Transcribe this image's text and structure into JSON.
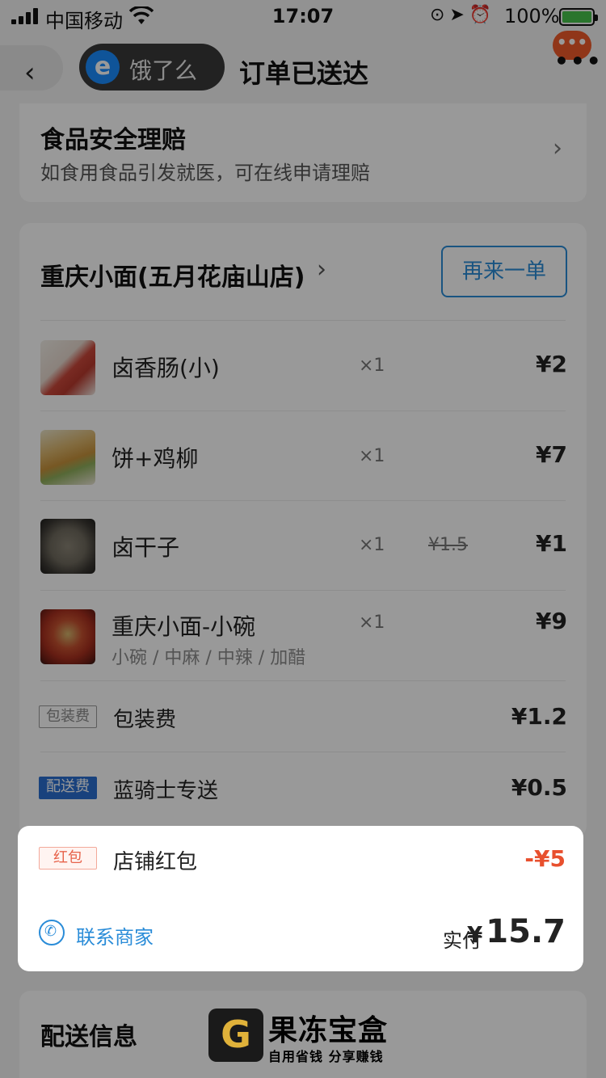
{
  "status_bar": {
    "carrier": "中国移动",
    "time": "17:07",
    "battery": "100%"
  },
  "nav": {
    "app_name": "饿了么",
    "app_logo": "e",
    "title": "订单已送达",
    "more_bubble": "•••"
  },
  "safety": {
    "title": "食品安全理赔",
    "subtitle": "如食用食品引发就医，可在线申请理赔"
  },
  "order": {
    "shop_name": "重庆小面(五月花庙山店)",
    "reorder_label": "再来一单",
    "items": [
      {
        "name": "卤香肠(小)",
        "qty": "×1",
        "original": "",
        "price": "¥2",
        "spec": ""
      },
      {
        "name": "饼+鸡柳",
        "qty": "×1",
        "original": "",
        "price": "¥7",
        "spec": ""
      },
      {
        "name": "卤干子",
        "qty": "×1",
        "original": "¥1.5",
        "price": "¥1",
        "spec": ""
      },
      {
        "name": "重庆小面-小碗",
        "qty": "×1",
        "original": "",
        "price": "¥9",
        "spec": "小碗 / 中麻 / 中辣 / 加醋"
      }
    ],
    "fees": [
      {
        "tag": "包装费",
        "label": "包装费",
        "value": "¥1.2"
      },
      {
        "tag": "配送费",
        "label": "蓝骑士专送",
        "value": "¥0.5"
      }
    ]
  },
  "summary": {
    "redpack_tag": "红包",
    "redpack_label": "店铺红包",
    "redpack_value": "-¥5",
    "contact_label": "联系商家",
    "paid_label": "实付",
    "paid_currency": "¥",
    "paid_value": "15.7"
  },
  "delivery": {
    "title": "配送信息"
  },
  "watermark": {
    "logo_letter": "G",
    "name": "果冻宝盒",
    "slogan": "自用省钱 分享赚钱"
  }
}
